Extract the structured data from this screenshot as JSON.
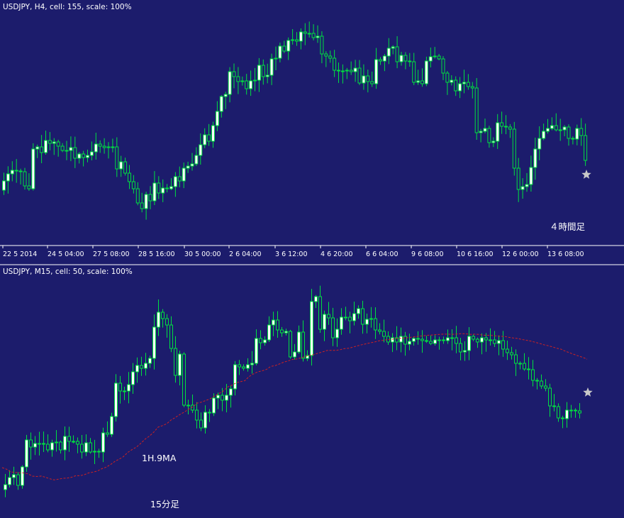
{
  "colors": {
    "background": "#1c1c6c",
    "bull_fill": "#ffffff",
    "candle_edge": "#00e040",
    "separator": "#ffffff",
    "ma_line": "#cc2222",
    "star": "#c8c8c8",
    "text": "#ffffff"
  },
  "chart_data": [
    {
      "type": "candlestick",
      "title": "USDJPY, H4, cell: 155, scale: 100%",
      "symbol": "USDJPY",
      "timeframe": "H4",
      "annotation": "４時間足",
      "x_tick_labels": [
        "22 5 2014",
        "24 5 04:00",
        "27 5 08:00",
        "28 5 16:00",
        "30 5 00:00",
        "2 6 04:00",
        "3 6 12:00",
        "4 6 20:00",
        "6 6 04:00",
        "9 6 08:00",
        "10 6 16:00",
        "12 6 00:00",
        "13 6 08:00"
      ],
      "closes": [
        255,
        245,
        240,
        241,
        242,
        262,
        266,
        210,
        207,
        215,
        198,
        202,
        200,
        206,
        212,
        212,
        208,
        223,
        217,
        222,
        219,
        214,
        203,
        206,
        208,
        207,
        207,
        238,
        228,
        244,
        256,
        266,
        286,
        294,
        274,
        283,
        258,
        272,
        265,
        266,
        263,
        249,
        255,
        237,
        234,
        231,
        219,
        204,
        190,
        199,
        177,
        157,
        136,
        133,
        101,
        108,
        115,
        114,
        125,
        114,
        113,
        92,
        108,
        106,
        83,
        82,
        65,
        72,
        57,
        56,
        58,
        45,
        47,
        47,
        53,
        51,
        76,
        79,
        82,
        99,
        100,
        100,
        99,
        101,
        96,
        117,
        107,
        115,
        118,
        84,
        86,
        79,
        68,
        66,
        87,
        78,
        86,
        87,
        116,
        114,
        118,
        86,
        80,
        79,
        83,
        103,
        116,
        113,
        128,
        118,
        116,
        122,
        124,
        187,
        185,
        181,
        201,
        199,
        173,
        178,
        179,
        182,
        237,
        267,
        263,
        260,
        236,
        210,
        195,
        185,
        181,
        177,
        183,
        183,
        179,
        195,
        196,
        181,
        191,
        226
      ],
      "ylim": [
        310,
        30
      ]
    },
    {
      "type": "candlestick",
      "title": "USDJPY, M15, cell: 50, scale: 100%",
      "symbol": "USDJPY",
      "timeframe": "M15",
      "overlay_label": "1H.9MA",
      "annotation": "15分足",
      "closes": [
        683,
        673,
        669,
        684,
        658,
        620,
        630,
        625,
        625,
        626,
        634,
        624,
        623,
        634,
        615,
        622,
        622,
        626,
        637,
        624,
        637,
        636,
        637,
        610,
        612,
        587,
        540,
        551,
        551,
        542,
        524,
        515,
        519,
        512,
        505,
        461,
        440,
        449,
        458,
        491,
        529,
        499,
        571,
        571,
        578,
        592,
        603,
        581,
        582,
        561,
        557,
        564,
        557,
        548,
        514,
        517,
        519,
        514,
        512,
        477,
        483,
        479,
        458,
        451,
        465,
        469,
        467,
        503,
        496,
        468,
        505,
        501,
        425,
        418,
        464,
        443,
        448,
        476,
        464,
        447,
        447,
        452,
        442,
        435,
        457,
        450,
        449,
        465,
        467,
        474,
        482,
        476,
        482,
        474,
        485,
        481,
        477,
        478,
        480,
        481,
        484,
        479,
        479,
        480,
        476,
        476,
        484,
        496,
        494,
        474,
        478,
        482,
        476,
        479,
        479,
        484,
        480,
        492,
        497,
        500,
        512,
        512,
        520,
        521,
        536,
        537,
        544,
        547,
        572,
        573,
        589,
        590,
        578,
        578,
        579,
        582
      ],
      "ma_values": [
        659.0,
        661.2,
        665.0,
        665.8,
        666.3,
        666.5,
        667.9,
        671.0,
        671.5,
        670.9,
        672.6,
        674.7,
        676.3,
        675.3,
        674.1,
        673.7,
        672.6,
        670.4,
        670.4,
        668.9,
        666.4,
        665.3,
        663.8,
        660.5,
        658.4,
        654.7,
        650.3,
        647.1,
        643.5,
        637.5,
        633.6,
        630.1,
        624.8,
        618.8,
        614.5,
        608.9,
        601.9,
        599.8,
        597.1,
        591.8,
        588.3,
        584.2,
        580.9,
        576.7,
        573.6,
        568.1,
        566.8,
        564.4,
        562.1,
        558.2,
        554.7,
        551.3,
        545.4,
        542.9,
        539.5,
        537.9,
        536.5,
        530.6,
        527.0,
        524.0,
        522.6,
        520.6,
        516.3,
        515.3,
        512.9,
        510.3,
        508.6,
        506.6,
        505.9,
        504.2,
        502.3,
        500.6,
        499.6,
        497.6,
        495.8,
        493.9,
        493.7,
        493.8,
        492.8,
        491.3,
        490.8,
        489.1,
        487.4,
        485.8,
        484.5,
        483.1,
        481.9,
        480.2,
        479.6,
        478.4,
        478.3,
        476.8,
        476.6,
        476.3,
        475.6,
        474.7,
        474.0,
        473.3,
        472.5,
        472.2,
        471.6,
        471.2,
        470.8,
        471.0,
        471.1,
        470.7,
        470.2,
        470.4,
        471.2,
        471.0,
        471.3,
        472.4,
        472.5,
        472.7,
        473.4,
        474.0,
        474.2,
        475.4,
        476.4,
        477.0,
        478.5,
        479.5,
        480.7,
        482.3,
        484.0,
        485.8,
        487.2,
        488.8,
        490.8,
        492.1,
        495.0,
        497.3,
        499.5,
        501.7,
        503.6,
        506.2
      ],
      "ylim": [
        715,
        400
      ]
    }
  ]
}
